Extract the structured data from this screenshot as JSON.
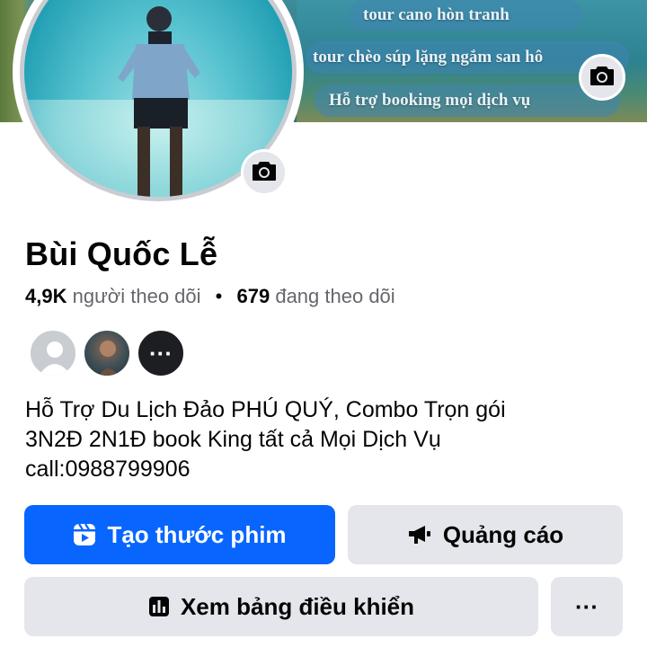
{
  "cover": {
    "lines": [
      "tour cano hòn tranh",
      "tour chèo súp lặng ngắm san hô",
      "Hỗ trợ booking mọi dịch vụ"
    ],
    "camera_icon": "camera-icon"
  },
  "avatar": {
    "camera_icon": "camera-icon"
  },
  "profile": {
    "name": "Bùi Quốc Lễ",
    "followers_count": "4,9K",
    "followers_label": "người theo dõi",
    "separator": "•",
    "following_count": "679",
    "following_label": "đang theo dõi"
  },
  "friends": {
    "more_label": "···"
  },
  "bio": {
    "line1": "Hỗ Trợ Du Lịch Đảo PHÚ QUÝ, Combo Trọn gói",
    "line2": "3N2Đ 2N1Đ book King tất cả Mọi Dịch Vụ",
    "line3": "call:0988799906"
  },
  "actions": {
    "create_reel": "Tạo thước phim",
    "ads": "Quảng cáo",
    "dashboard": "Xem bảng điều khiển",
    "more": "···"
  },
  "colors": {
    "primary": "#0866ff",
    "secondary_bg": "#e4e6eb",
    "muted_text": "#65676b"
  }
}
